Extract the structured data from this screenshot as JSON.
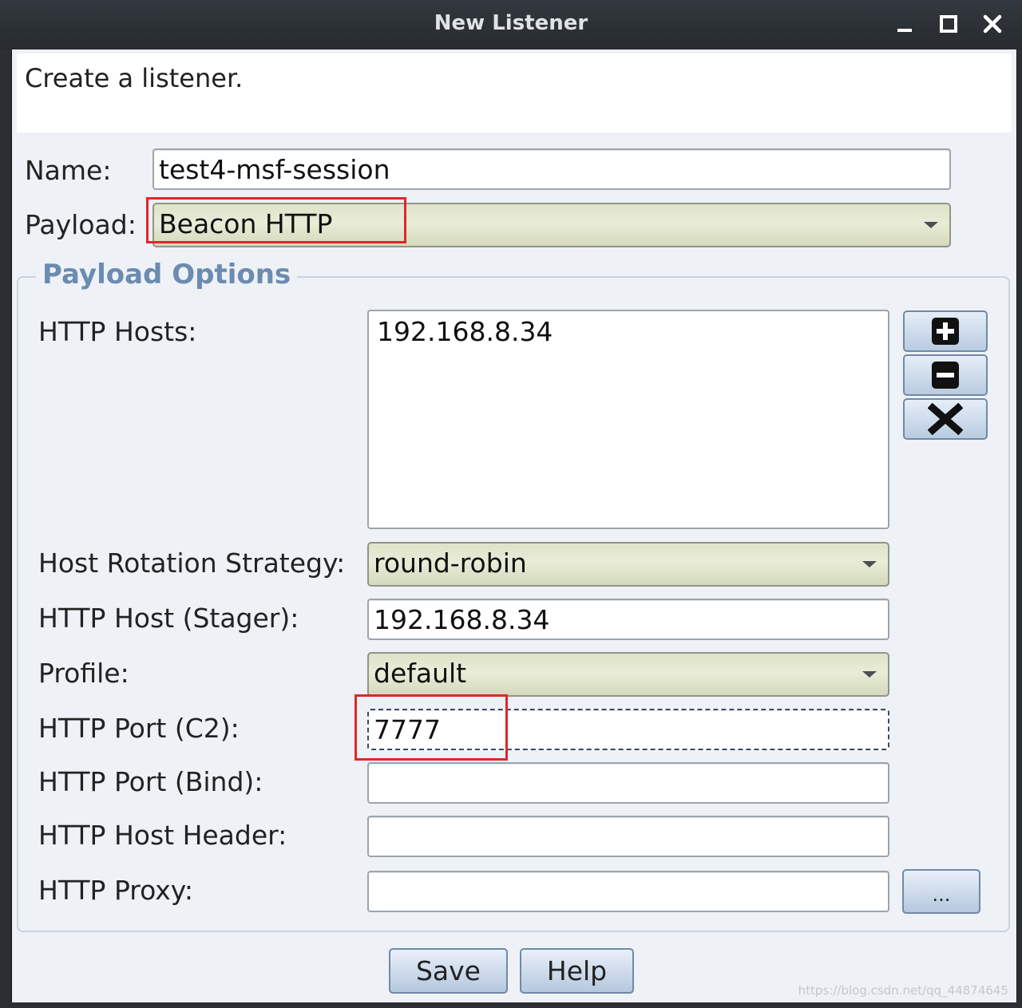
{
  "window": {
    "title": "New Listener",
    "controls": [
      "minimize",
      "maximize",
      "close"
    ]
  },
  "description": "Create a listener.",
  "fields": {
    "name_label": "Name:",
    "name_value": "test4-msf-session",
    "payload_label": "Payload:",
    "payload_value": "Beacon HTTP"
  },
  "payload_options": {
    "title": "Payload Options",
    "http_hosts_label": "HTTP Hosts:",
    "http_hosts": [
      "192.168.8.34"
    ],
    "host_rotation_label": "Host Rotation Strategy:",
    "host_rotation_value": "round-robin",
    "stager_label": "HTTP Host (Stager):",
    "stager_value": "192.168.8.34",
    "profile_label": "Profile:",
    "profile_value": "default",
    "port_c2_label": "HTTP Port (C2):",
    "port_c2_value": "7777",
    "port_bind_label": "HTTP Port (Bind):",
    "port_bind_value": "",
    "host_header_label": "HTTP Host Header:",
    "host_header_value": "",
    "proxy_label": "HTTP Proxy:",
    "proxy_value": "",
    "proxy_button": "..."
  },
  "buttons": {
    "save": "Save",
    "help": "Help"
  },
  "icons": [
    "add-icon",
    "remove-icon",
    "clear-icon"
  ],
  "colors": {
    "highlight": "#e0262b",
    "group_title": "#6b8bb1",
    "combo_bg": "#e3e6cf"
  },
  "watermark": "https://blog.csdn.net/qq_44874645"
}
